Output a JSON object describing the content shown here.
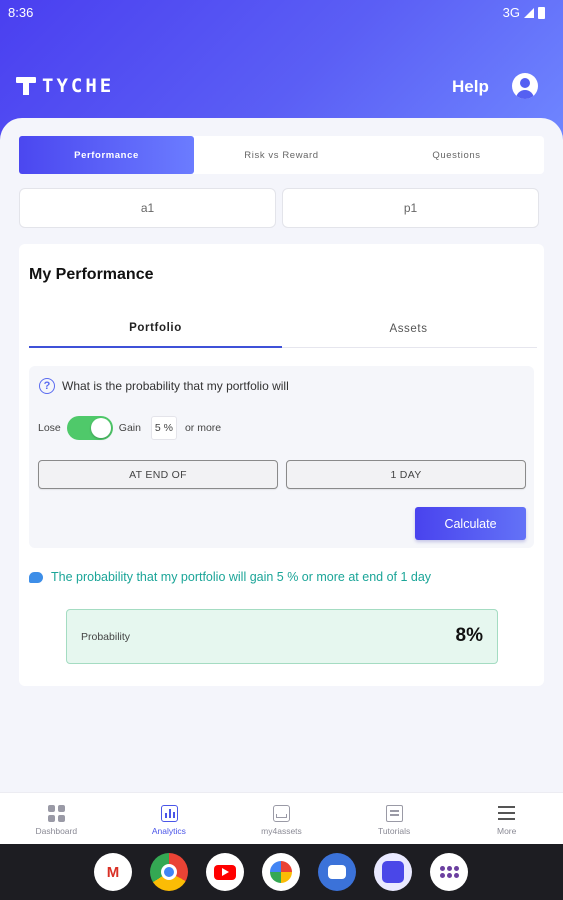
{
  "status_bar": {
    "time": "8:36",
    "network": "3G"
  },
  "header": {
    "brand": "TYCHE",
    "help_label": "Help"
  },
  "top_tabs": [
    {
      "label": "Performance"
    },
    {
      "label": "Risk vs Reward"
    },
    {
      "label": "Questions"
    }
  ],
  "selectors": {
    "left": "a1",
    "right": "p1"
  },
  "performance": {
    "title": "My Performance",
    "subtabs": [
      {
        "label": "Portfolio"
      },
      {
        "label": "Assets"
      }
    ],
    "question": "What is the probability that my portfolio will",
    "lose_label": "Lose",
    "gain_label": "Gain",
    "toggle_state": "gain",
    "percent_value": "5 %",
    "or_more_label": "or more",
    "timing_option": "AT END OF",
    "period_option": "1 DAY",
    "calculate_label": "Calculate",
    "answer_text": "The probability that my portfolio will gain 5 % or more at end of 1 day",
    "probability_label": "Probability",
    "probability_value": "8%"
  },
  "bottom_nav": [
    {
      "label": "Dashboard"
    },
    {
      "label": "Analytics"
    },
    {
      "label": "my4assets"
    },
    {
      "label": "Tutorials"
    },
    {
      "label": "More"
    }
  ],
  "dock_apps": [
    "gmail-icon",
    "chrome-icon",
    "youtube-icon",
    "photos-icon",
    "messages-icon",
    "tyche-icon",
    "app-drawer-icon"
  ],
  "colors": {
    "accent": "#4b47f0",
    "toggle_on": "#4fc96a",
    "answer_text": "#1ba598",
    "probability_bg": "#e6f7ef"
  }
}
